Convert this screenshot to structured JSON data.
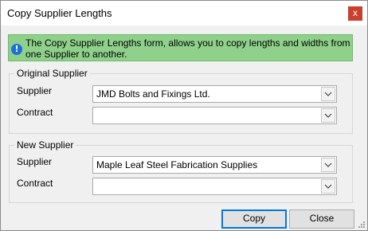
{
  "window": {
    "title": "Copy Supplier Lengths",
    "close_glyph": "x"
  },
  "info": {
    "icon": "info-icon",
    "icon_glyph": "!",
    "text": "The Copy Supplier Lengths form, allows you to copy lengths and widths from one Supplier to another."
  },
  "original": {
    "legend": "Original Supplier",
    "supplier_label": "Supplier",
    "supplier_value": "JMD Bolts and Fixings Ltd.",
    "contract_label": "Contract",
    "contract_value": ""
  },
  "new": {
    "legend": "New Supplier",
    "supplier_label": "Supplier",
    "supplier_value": "Maple Leaf Steel Fabrication Supplies",
    "contract_label": "Contract",
    "contract_value": ""
  },
  "buttons": {
    "copy": "Copy",
    "close": "Close"
  },
  "colors": {
    "banner": "#8fd18b",
    "close_button": "#c8412e",
    "focus": "#0078d7"
  }
}
